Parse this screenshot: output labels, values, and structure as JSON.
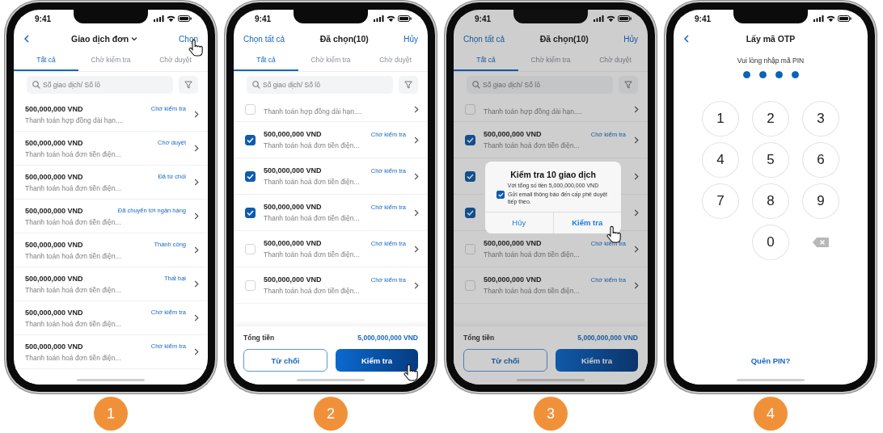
{
  "phones": [
    {
      "kind": "list",
      "step": "1",
      "time": "9:41",
      "header": {
        "title": "Giao dịch đơn",
        "action": "Chọn"
      },
      "tabs": [
        {
          "label": "Tất cả",
          "selected": true
        },
        {
          "label": "Chờ kiểm tra",
          "selected": false
        },
        {
          "label": "Chờ duyệt",
          "selected": false
        }
      ],
      "search": {
        "placeholder": "Số giao dịch/ Số lô"
      },
      "rows": [
        {
          "title": "500,000,000 VND",
          "status": "Chờ kiểm tra",
          "subtitle": "Thanh toán hợp đồng dài hạn...."
        },
        {
          "title": "500,000,000 VND",
          "status": "Chờ duyệt",
          "subtitle": "Thanh toán hoá đơn tiền điện..."
        },
        {
          "title": "500,000,000 VND",
          "status": "Đã từ chối",
          "subtitle": "Thanh toán hoá đơn tiền điện..."
        },
        {
          "title": "500,000,000 VND",
          "status": "Đã chuyển tới ngân hàng",
          "subtitle": "Thanh toán hoá đơn tiền điện..."
        },
        {
          "title": "500,000,000 VND",
          "status": "Thành công",
          "subtitle": "Thanh toán hoá đơn tiền điện..."
        },
        {
          "title": "500,000,000 VND",
          "status": "Thất bại",
          "subtitle": "Thanh toán hoá đơn tiền điện..."
        },
        {
          "title": "500,000,000 VND",
          "status": "Chờ kiểm tra",
          "subtitle": "Thanh toán hoá đơn tiền điện..."
        },
        {
          "title": "500,000,000 VND",
          "status": "Chờ kiểm tra",
          "subtitle": "Thanh toán hoá đơn tiền điện..."
        }
      ]
    },
    {
      "kind": "select",
      "step": "2",
      "time": "9:41",
      "header": {
        "left": "Chọn tất cả",
        "title": "Đã chọn(10)",
        "right": "Hủy"
      },
      "tabs": [
        {
          "label": "Tất cả",
          "selected": true
        },
        {
          "label": "Chờ kiểm tra",
          "selected": false
        },
        {
          "label": "Chờ duyệt",
          "selected": false
        }
      ],
      "search": {
        "placeholder": "Số giao dịch/ Số lô"
      },
      "rows": [
        {
          "checked": false,
          "subtitle": "Thanh toán hợp đồng dài hạn...."
        },
        {
          "checked": true,
          "title": "500,000,000 VND",
          "status": "Chờ kiểm tra",
          "subtitle": "Thanh toán hoá đơn tiền điện..."
        },
        {
          "checked": true,
          "title": "500,000,000 VND",
          "status": "Chờ kiểm tra",
          "subtitle": "Thanh toán hoá đơn tiền điện..."
        },
        {
          "checked": true,
          "title": "500,000,000 VND",
          "status": "Chờ kiểm tra",
          "subtitle": "Thanh toán hoá đơn tiền điện..."
        },
        {
          "checked": false,
          "title": "500,000,000 VND",
          "status": "Chờ kiểm tra",
          "subtitle": "Thanh toán hoá đơn tiền điện..."
        },
        {
          "checked": false,
          "title": "500,000,000 VND",
          "status": "Chờ kiểm tra",
          "subtitle": "Thanh toán hoá đơn tiền điện..."
        }
      ],
      "total": {
        "label": "Tổng tiền",
        "value": "5,000,000,000 VND"
      },
      "buttons": [
        {
          "label": "Từ chối",
          "kind": "outline"
        },
        {
          "label": "Kiểm tra",
          "kind": "primary"
        }
      ]
    },
    {
      "kind": "select",
      "step": "3",
      "time": "9:41",
      "header": {
        "left": "Chọn tất cả",
        "title": "Đã chọn(10)",
        "right": "Hủy"
      },
      "tabs": [
        {
          "label": "Tất cả",
          "selected": true
        },
        {
          "label": "Chờ kiểm tra",
          "selected": false
        },
        {
          "label": "Chờ duyệt",
          "selected": false
        }
      ],
      "search": {
        "placeholder": "Số giao dịch/ Số lô"
      },
      "rows": [
        {
          "checked": false,
          "subtitle": "Thanh toán hợp đồng dài hạn...."
        },
        {
          "checked": true,
          "title": "500,000,000 VND",
          "status": "Chờ kiểm tra",
          "subtitle": "Thanh toán hoá đơn tiền điện..."
        },
        {
          "checked": true
        },
        {
          "checked": true
        },
        {
          "checked": false,
          "title": "500,000,000 VND",
          "status": "Chờ kiểm tra",
          "subtitle": "Thanh toán hoá đơn tiền điện..."
        },
        {
          "checked": false,
          "title": "500,000,000 VND",
          "status": "Chờ kiểm tra",
          "subtitle": "Thanh toán hoá đơn tiền điện..."
        }
      ],
      "total": {
        "label": "Tổng tiền",
        "value": "5,000,000,000 VND"
      },
      "buttons": [
        {
          "label": "Từ chối",
          "kind": "outline"
        },
        {
          "label": "Kiểm tra",
          "kind": "primary"
        }
      ],
      "dialog": {
        "title": "Kiểm tra 10 giao dịch",
        "message": "Với tổng số tiền 5,000,000,000 VND",
        "checkbox": {
          "label": "Gửi email thông báo đến cấp phê duyệt tiếp theo.",
          "checked": true
        },
        "buttons": [
          "Hủy",
          "Kiểm tra"
        ]
      }
    },
    {
      "kind": "pin",
      "step": "4",
      "time": "9:41",
      "header": {
        "title": "Lấy mã OTP"
      },
      "prompt": "Vui lòng nhập mã PIN",
      "pin_dots": [
        {
          "filled": true
        },
        {
          "filled": true
        },
        {
          "filled": true
        },
        {
          "filled": true
        }
      ],
      "keys": [
        {
          "kind": "digit",
          "label": "1"
        },
        {
          "kind": "digit",
          "label": "2"
        },
        {
          "kind": "digit",
          "label": "3"
        },
        {
          "kind": "digit",
          "label": "4"
        },
        {
          "kind": "digit",
          "label": "5"
        },
        {
          "kind": "digit",
          "label": "6"
        },
        {
          "kind": "digit",
          "label": "7"
        },
        {
          "kind": "digit",
          "label": "8"
        },
        {
          "kind": "digit",
          "label": "9"
        },
        {
          "kind": "digit",
          "label": "0"
        },
        {
          "kind": "backspace"
        }
      ],
      "link": "Quên PIN?"
    }
  ]
}
